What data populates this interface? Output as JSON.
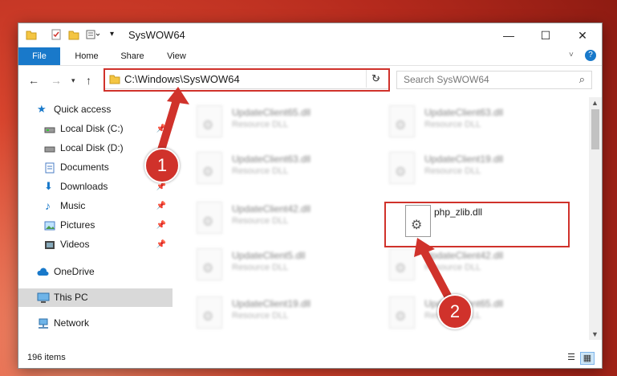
{
  "window": {
    "title": "SysWOW64"
  },
  "ribbon": {
    "tabs": [
      "File",
      "Home",
      "Share",
      "View"
    ]
  },
  "address": {
    "path": "C:\\Windows\\SysWOW64"
  },
  "search": {
    "placeholder": "Search SysWOW64"
  },
  "sidebar": {
    "items": [
      {
        "label": "Quick access",
        "icon": "star-icon"
      },
      {
        "label": "Local Disk (C:)",
        "icon": "drive-icon"
      },
      {
        "label": "Local Disk (D:)",
        "icon": "drive-icon"
      },
      {
        "label": "Documents",
        "icon": "documents-icon"
      },
      {
        "label": "Downloads",
        "icon": "downloads-icon"
      },
      {
        "label": "Music",
        "icon": "music-icon"
      },
      {
        "label": "Pictures",
        "icon": "pictures-icon"
      },
      {
        "label": "Videos",
        "icon": "videos-icon"
      },
      {
        "label": "OneDrive",
        "icon": "cloud-icon"
      },
      {
        "label": "This PC",
        "icon": "computer-icon"
      },
      {
        "label": "Network",
        "icon": "network-icon"
      }
    ]
  },
  "files": [
    {
      "name": "UpdateClient65.dll",
      "type": "Resource DLL"
    },
    {
      "name": "UpdateClient63.dll",
      "type": "Resource DLL"
    },
    {
      "name": "UpdateClient63.dll",
      "type": "Resource DLL"
    },
    {
      "name": "UpdateClient19.dll",
      "type": "Resource DLL"
    },
    {
      "name": "UpdateClient42.dll",
      "type": "Resource DLL"
    },
    {
      "name": "php_zlib.dll",
      "type": ""
    },
    {
      "name": "UpdateClient5.dll",
      "type": "Resource DLL"
    },
    {
      "name": "UpdateClient42.dll",
      "type": "Resource DLL"
    },
    {
      "name": "UpdateClient19.dll",
      "type": "Resource DLL"
    },
    {
      "name": "UpdateClient65.dll",
      "type": "Resource DLL"
    }
  ],
  "status": {
    "item_count": "196 items"
  },
  "callouts": [
    "1",
    "2"
  ],
  "colors": {
    "accent": "#1979ca",
    "highlight": "#d0322b"
  }
}
